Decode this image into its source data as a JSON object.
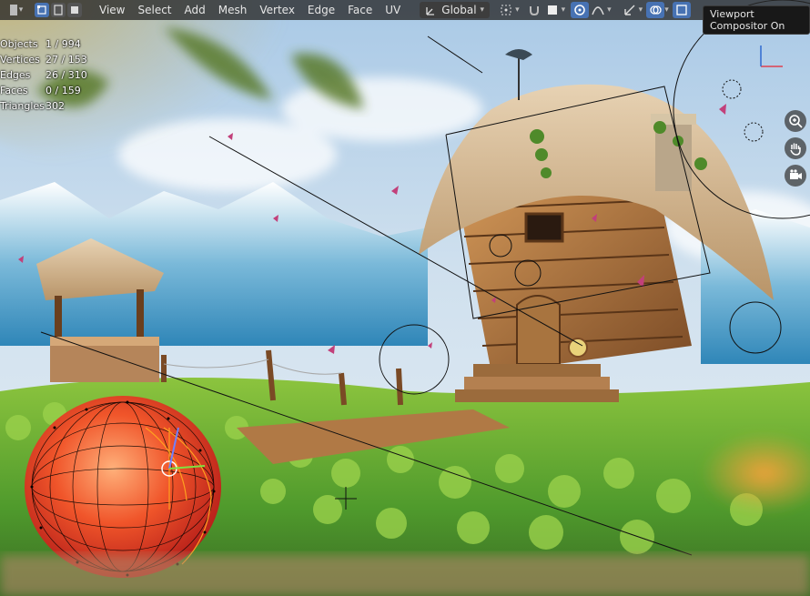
{
  "header": {
    "menus": [
      {
        "key": "view",
        "label": "View"
      },
      {
        "key": "select",
        "label": "Select"
      },
      {
        "key": "add",
        "label": "Add"
      },
      {
        "key": "mesh",
        "label": "Mesh"
      },
      {
        "key": "vertex",
        "label": "Vertex"
      },
      {
        "key": "edge",
        "label": "Edge"
      },
      {
        "key": "face",
        "label": "Face"
      },
      {
        "key": "uv",
        "label": "UV"
      }
    ],
    "transform_orientation": "Global",
    "select_modes": [
      "vertex-select-mode-icon",
      "edge-select-mode-icon",
      "face-select-mode-icon"
    ],
    "active_select_mode": "vertex"
  },
  "stats": {
    "objects": {
      "label": "Objects",
      "value": "1 / 994"
    },
    "vertices": {
      "label": "Vertices",
      "value": "27 / 153"
    },
    "edges": {
      "label": "Edges",
      "value": "26 / 310"
    },
    "faces": {
      "label": "Faces",
      "value": "0 / 159"
    },
    "triangles": {
      "label": "Triangles",
      "value": "302"
    }
  },
  "tooltip": "Viewport Compositor On",
  "navigation": [
    "zoom-icon",
    "pan-hand-icon",
    "camera-icon"
  ],
  "colors": {
    "header_bg": "#282828",
    "accent_blue": "#4772b3",
    "selected_orange": "#ffa020",
    "sky": "#9fc6e6",
    "grass": "#6fb83a"
  }
}
